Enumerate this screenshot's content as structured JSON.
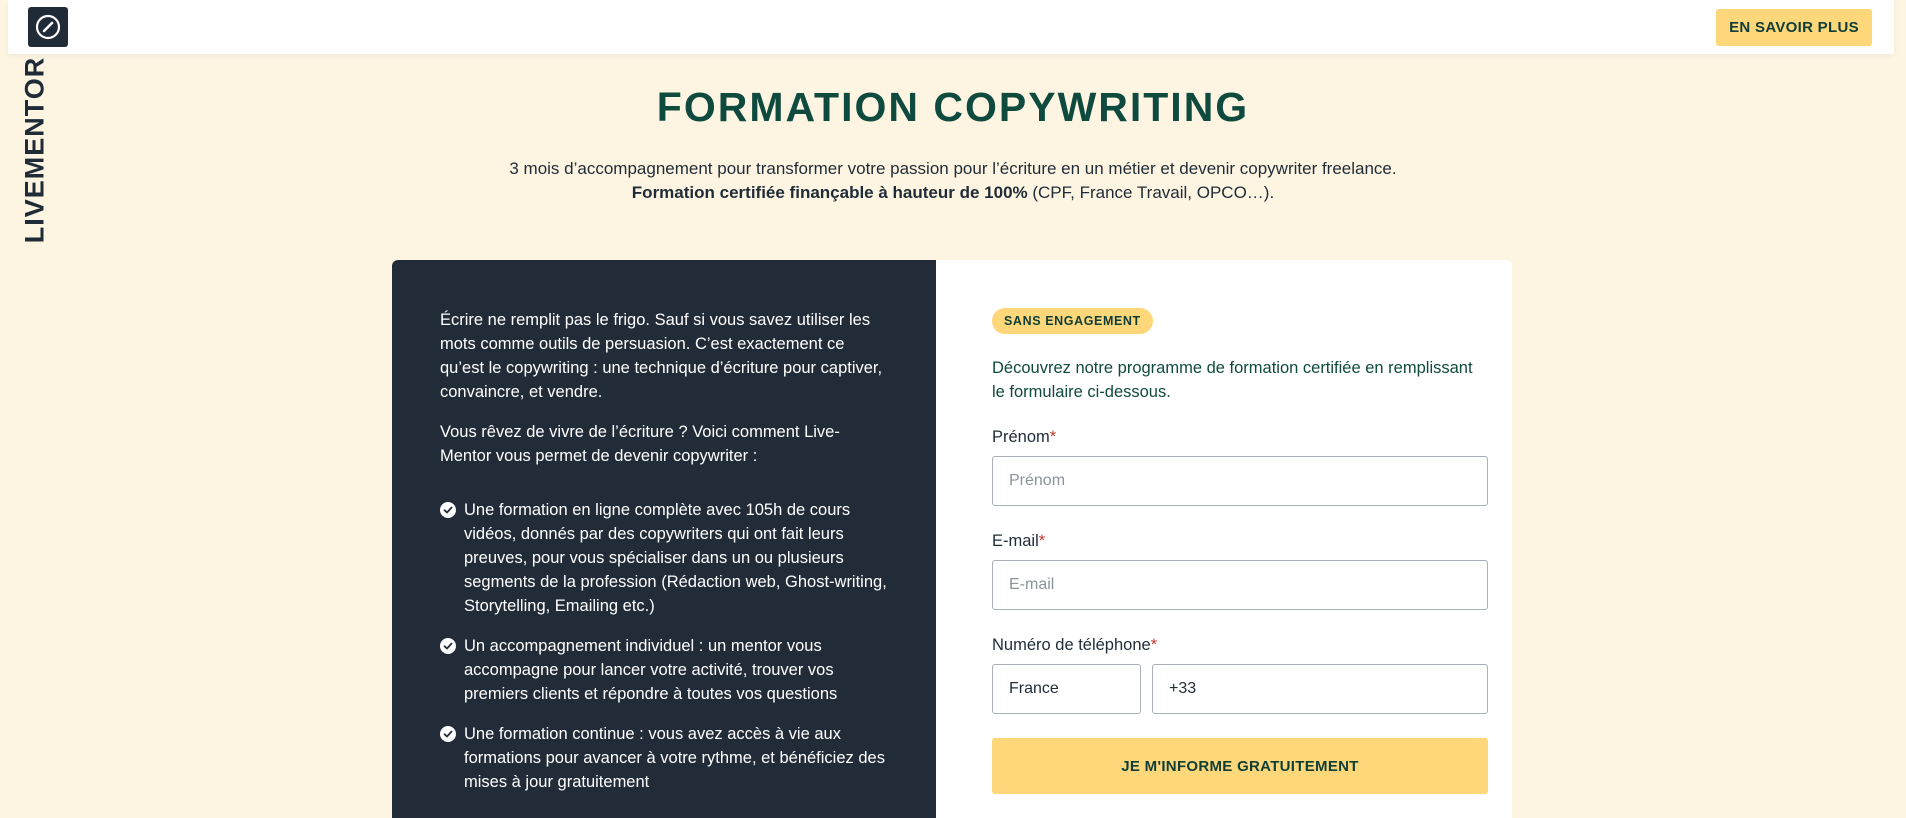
{
  "header": {
    "brand_name": "LIVEMENTOR",
    "cta_label": "EN SAVOIR PLUS",
    "logo_icon": "compass-icon"
  },
  "hero": {
    "title": "FORMATION COPYWRITING",
    "subtitle_line1": "3 mois d’accompagnement pour transformer votre passion pour l’écriture en un métier et devenir copywriter freelance.",
    "subtitle_line2_bold": "Formation certifiée finançable à hauteur de 100%",
    "subtitle_line2_rest": " (CPF, France Travail, OPCO…)."
  },
  "left_panel": {
    "paragraphs": [
      "Écrire ne remplit pas le frigo. Sauf si vous savez utiliser les mots comme outils de persuasion. C’est exactement ce qu’est le copywriting : une technique d’écriture pour captiver, convaincre, et vendre.",
      "Vous rêvez de vivre de l’écriture ? Voici comment Live-Mentor vous permet de devenir copywriter :"
    ],
    "bullets": [
      "Une formation en ligne complète avec 105h de cours vidéos, donnés par des copywriters qui ont fait leurs preuves, pour vous spécialiser dans un ou plusieurs segments de la profession (Rédaction web, Ghost-writing, Storytelling, Emailing etc.)",
      "Un accompagnement individuel : un mentor vous accompagne pour lancer votre activité, trouver vos premiers clients et répondre à toutes vos questions",
      "Une formation continue : vous avez accès à vie aux formations pour avancer à votre rythme, et bénéficiez des mises à jour gratuitement"
    ]
  },
  "form": {
    "badge": "SANS ENGAGEMENT",
    "intro": "Découvrez notre programme de formation certifiée en remplissant le formulaire ci-dessous.",
    "required_mark": "*",
    "first_name": {
      "label": "Prénom",
      "placeholder": "Prénom",
      "value": ""
    },
    "email": {
      "label": "E-mail",
      "placeholder": "E-mail",
      "value": ""
    },
    "phone": {
      "label": "Numéro de téléphone",
      "country": "France",
      "prefix_value": "+33"
    },
    "submit_label": "JE M'INFORME GRATUITEMENT"
  },
  "colors": {
    "background": "#fdf5e2",
    "accent_yellow": "#fdd77a",
    "dark_panel": "#222c38",
    "title_green": "#0f4a3f"
  }
}
